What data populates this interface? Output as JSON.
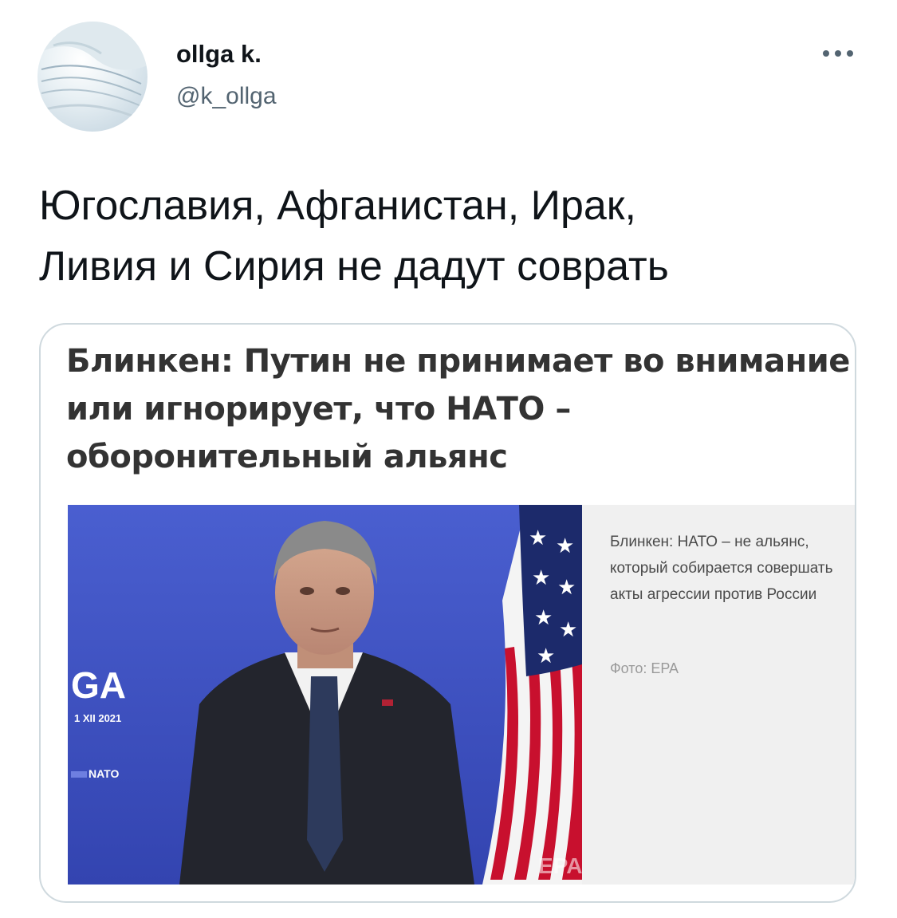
{
  "author": {
    "display_name": "ollga k.",
    "handle": "@k_ollga"
  },
  "tweet": {
    "text": "Югославия, Афганистан, Ирак,\nЛивия и Сирия не дадут соврать"
  },
  "card": {
    "headline": "Блинкен: Путин не принимает во внимание или игнорирует, что НАТО – оборонительный альянс",
    "caption": "Блинкен: НАТО – не альянс, который собирается совершать акты агрессии против России",
    "credit": "Фото: EPA",
    "backdrop_text": "GA",
    "backdrop_date": "1 XII 2021",
    "backdrop_nato": "NATO",
    "watermark": "EPA"
  },
  "icons": {
    "more": "more-horizontal-icon"
  },
  "colors": {
    "text_primary": "#0f1419",
    "text_secondary": "#536471",
    "card_border": "#cfd9de",
    "backdrop_blue": "#3b4fc0",
    "flag_red": "#c8102e",
    "flag_blue": "#1c2a6b"
  }
}
